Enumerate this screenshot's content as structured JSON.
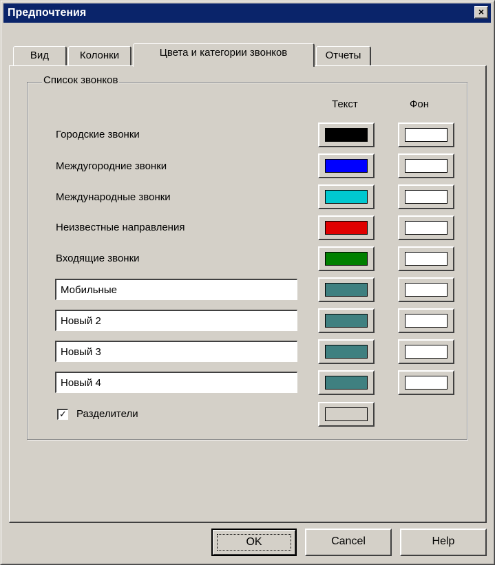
{
  "window": {
    "title": "Предпочтения",
    "close_glyph": "×"
  },
  "tabs": [
    {
      "label": "Вид"
    },
    {
      "label": "Колонки"
    },
    {
      "label": "Цвета и категории звонков"
    },
    {
      "label": "Отчеты"
    }
  ],
  "group": {
    "title": "Список звонков"
  },
  "columns": {
    "text": "Текст",
    "background": "Фон"
  },
  "rows": [
    {
      "label": "Городские звонки",
      "text_color": "#000000",
      "bg_color": "#ffffff"
    },
    {
      "label": "Междугородние звонки",
      "text_color": "#0000ff",
      "bg_color": "#ffffff"
    },
    {
      "label": "Международные звонки",
      "text_color": "#00c8d0",
      "bg_color": "#ffffff"
    },
    {
      "label": "Неизвестные направления",
      "text_color": "#e00000",
      "bg_color": "#ffffff"
    },
    {
      "label": "Входящие звонки",
      "text_color": "#008000",
      "bg_color": "#ffffff"
    }
  ],
  "custom_rows": [
    {
      "value": "Мобильные",
      "text_color": "#3f8080",
      "bg_color": "#ffffff"
    },
    {
      "value": "Новый 2",
      "text_color": "#3f8080",
      "bg_color": "#ffffff"
    },
    {
      "value": "Новый 3",
      "text_color": "#3f8080",
      "bg_color": "#ffffff"
    },
    {
      "value": "Новый 4",
      "text_color": "#3f8080",
      "bg_color": "#ffffff"
    }
  ],
  "separators": {
    "label": "Разделители",
    "checked": true,
    "check_glyph": "✓",
    "color": "#d4d0c8"
  },
  "buttons": {
    "ok": "OK",
    "cancel": "Cancel",
    "help": "Help"
  }
}
